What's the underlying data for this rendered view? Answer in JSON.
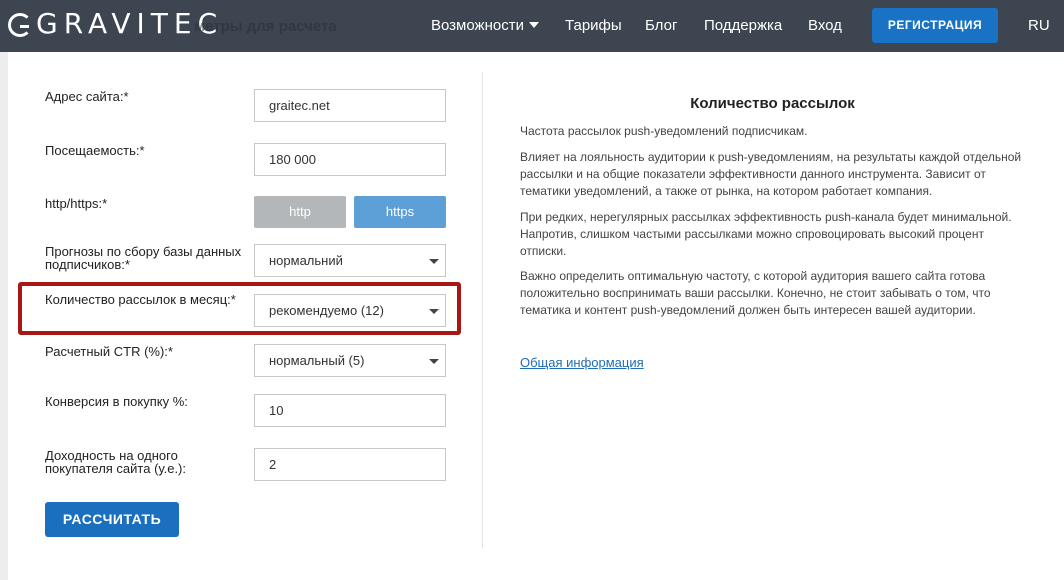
{
  "header": {
    "logo": "GRAVITEC",
    "ghost_title": "метры для расчета",
    "nav": {
      "features": "Возможности",
      "pricing": "Тарифы",
      "blog": "Блог",
      "support": "Поддержка",
      "login": "Вход"
    },
    "register_label": "РЕГИСТРАЦИЯ",
    "language": "RU"
  },
  "form": {
    "site_address": {
      "label": "Адрес сайта:*",
      "value": "graitec.net"
    },
    "traffic": {
      "label": "Посещаемость:*",
      "value": "180 000"
    },
    "protocol": {
      "label": "http/https:*",
      "options": [
        "http",
        "https"
      ],
      "selected": "https"
    },
    "forecast": {
      "label": "Прогнозы по сбору базы данных подписчиков:*",
      "value": "нормальний"
    },
    "mailings": {
      "label": "Количество рассылок в месяц:*",
      "value": "рекомендуемо (12)"
    },
    "ctr": {
      "label": "Расчетный CTR (%):*",
      "value": "нормальный (5)"
    },
    "conversion": {
      "label": "Конверсия в покупку %:",
      "value": "10"
    },
    "revenue": {
      "label": "Доходность на одного покупателя сайта (у.е.):",
      "value": "2"
    },
    "calculate_label": "РАССЧИТАТЬ"
  },
  "info": {
    "title": "Количество рассылок",
    "paragraphs": [
      "Частота рассылок push-уведомлений подписчикам.",
      "Влияет на лояльность аудитории к push-уведомлениям, на результаты каждой отдельной рассылки и на общие показатели эффективности данного инструмента. Зависит от тематики уведомлений, а также от рынка, на котором работает компания.",
      "При редких, нерегулярных рассылках эффективность push-канала будет минимальной. Напротив, слишком частыми рассылками можно спровоцировать высокий процент отписки.",
      "Важно определить оптимальную частоту, с которой аудитория вашего сайта готова положительно воспринимать ваши рассылки. Конечно, не стоит забывать о том, что тематика и контент push-уведомлений должен быть интересен вашей аудитории."
    ],
    "link": "Общая информация"
  },
  "colors": {
    "topbar": "#3c4550",
    "accent_blue": "#1a72c4",
    "highlight_red": "#a81616"
  }
}
